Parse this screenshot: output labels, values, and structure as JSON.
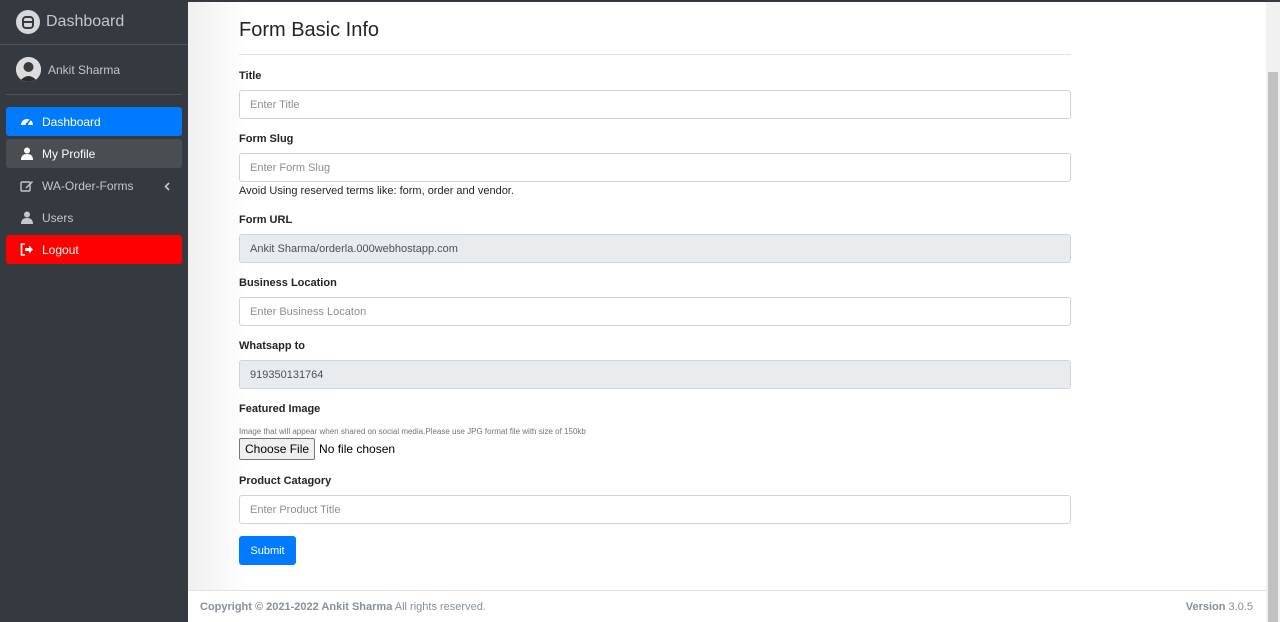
{
  "sidebar": {
    "brand": "Dashboard",
    "user_name": "Ankit Sharma",
    "items": [
      {
        "label": "Dashboard",
        "icon": "tachometer-icon"
      },
      {
        "label": "My Profile",
        "icon": "user-icon"
      },
      {
        "label": "WA-Order-Forms",
        "icon": "edit-icon"
      },
      {
        "label": "Users",
        "icon": "user-icon"
      },
      {
        "label": "Logout",
        "icon": "sign-out-icon"
      }
    ]
  },
  "form": {
    "title": "Form Basic Info",
    "fields": {
      "title": {
        "label": "Title",
        "placeholder": "Enter Title",
        "value": ""
      },
      "slug": {
        "label": "Form Slug",
        "placeholder": "Enter Form Slug",
        "value": "",
        "help": "Avoid Using reserved terms like: form, order and vendor."
      },
      "url": {
        "label": "Form URL",
        "value": "Ankit Sharma/orderla.000webhostapp.com"
      },
      "location": {
        "label": "Business Location",
        "placeholder": "Enter Business Locaton",
        "value": ""
      },
      "whatsapp": {
        "label": "Whatsapp to",
        "value": "919350131764"
      },
      "image": {
        "label": "Featured Image",
        "help": "Image that will appear when shared on social media.Please use JPG format file with size of 150kb",
        "button": "Choose File",
        "status": "No file chosen"
      },
      "category": {
        "label": "Product Catagory",
        "placeholder": "Enter Product Title",
        "value": ""
      }
    },
    "submit": "Submit"
  },
  "footer": {
    "copyright_bold": "Copyright © 2021-2022 Ankit Sharma",
    "copyright_rest": " All rights reserved.",
    "version_label": "Version",
    "version_value": " 3.0.5"
  },
  "colors": {
    "sidebar_bg": "#343a40",
    "primary": "#007bff",
    "logout": "#ff0000"
  }
}
